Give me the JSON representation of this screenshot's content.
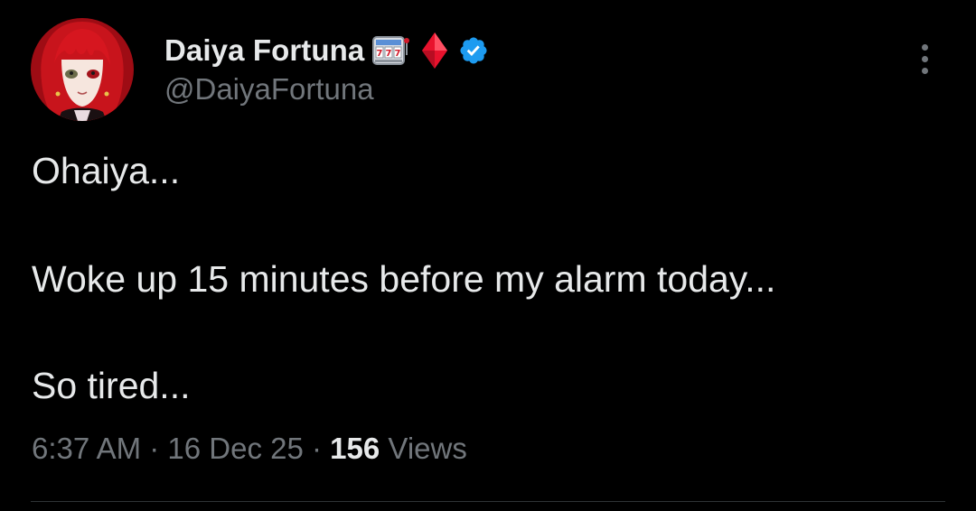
{
  "author": {
    "display_name": "Daiya Fortuna",
    "handle": "@DaiyaFortuna",
    "badges": [
      "slot-machine-emoji",
      "red-diamond-emoji",
      "verified-badge-icon"
    ],
    "verified_color": "#1d9bf0"
  },
  "tweet": {
    "lines": [
      "Ohaiya...",
      "Woke up 15 minutes before my alarm today...",
      "So tired..."
    ],
    "time": "6:37 AM",
    "separator": " · ",
    "date": "16 Dec 25",
    "views_count": "156",
    "views_label": " Views"
  },
  "colors": {
    "background": "#000000",
    "primary_text": "#e7e9ea",
    "secondary_text": "#71767b",
    "divider": "#2f3336"
  }
}
